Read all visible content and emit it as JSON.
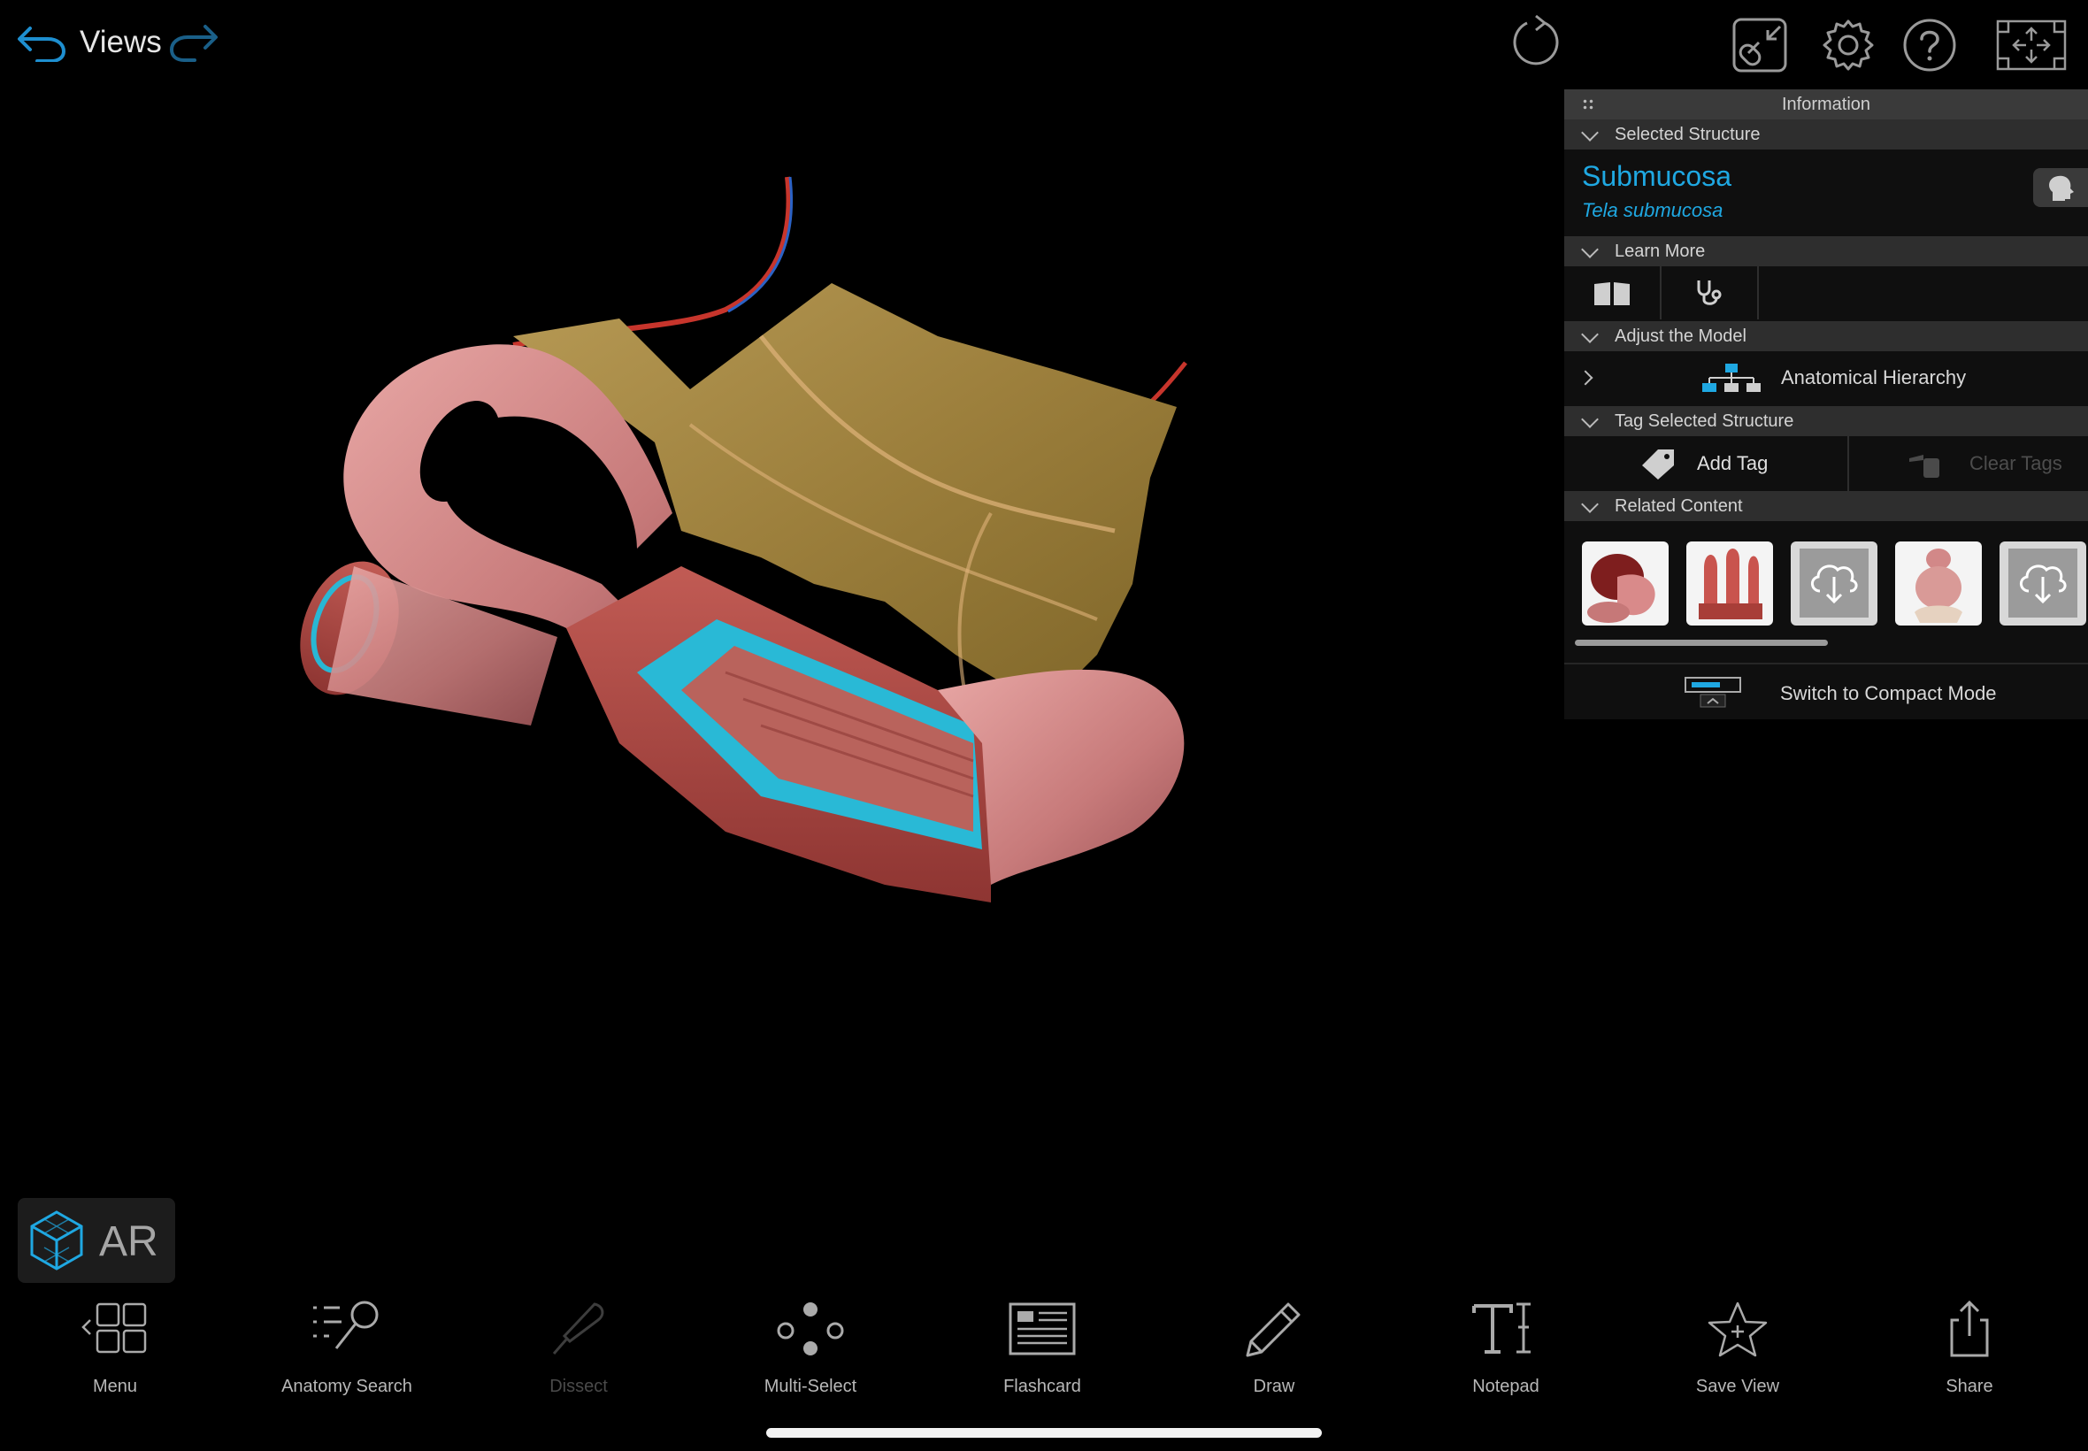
{
  "top": {
    "views_label": "Views",
    "icons": [
      "undo-icon",
      "redo-icon",
      "reset-rotation-icon",
      "link-icon",
      "gear-icon",
      "help-icon",
      "fullscreen-icon"
    ]
  },
  "panel": {
    "title": "Information",
    "sections": {
      "selected_structure": "Selected Structure",
      "learn_more": "Learn More",
      "adjust_model": "Adjust the Model",
      "tag_selected": "Tag Selected Structure",
      "related_content": "Related Content"
    },
    "structure": {
      "name": "Submucosa",
      "latin": "Tela submucosa"
    },
    "hierarchy_label": "Anatomical Hierarchy",
    "add_tag": "Add Tag",
    "clear_tags": "Clear Tags",
    "compact_mode": "Switch to Compact Mode"
  },
  "ar_label": "AR",
  "toolbar": {
    "menu": "Menu",
    "search": "Anatomy Search",
    "dissect": "Dissect",
    "multiselect": "Multi-Select",
    "flashcard": "Flashcard",
    "draw": "Draw",
    "notepad": "Notepad",
    "saveview": "Save View",
    "share": "Share"
  },
  "colors": {
    "accent_blue": "#1fa8e2",
    "panel_header": "#3a3a3a",
    "section_header": "#2e2e2e"
  }
}
